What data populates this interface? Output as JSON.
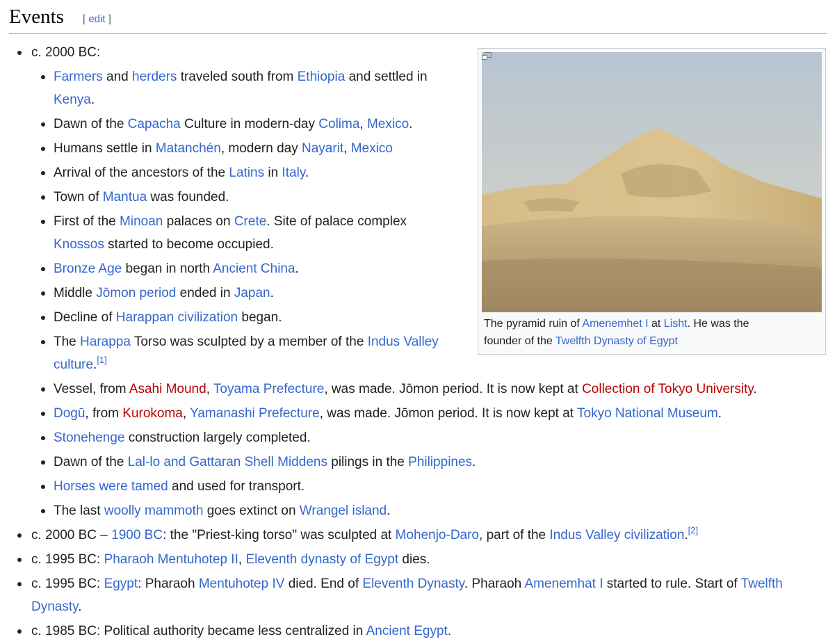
{
  "section": {
    "title": "Events",
    "edit_open": "[ ",
    "edit_label": "edit",
    "edit_close": " ]"
  },
  "figure": {
    "caption": [
      {
        "t": "The pyramid ruin of "
      },
      {
        "t": "Amenemhet I",
        "l": "blue"
      },
      {
        "t": " at "
      },
      {
        "t": "Lisht",
        "l": "blue"
      },
      {
        "t": ". He was the founder of the "
      },
      {
        "t": "Twelfth Dynasty of Egypt",
        "l": "blue"
      }
    ]
  },
  "events": [
    {
      "text": [
        {
          "t": "c. 2000 BC:"
        }
      ],
      "sub": [
        [
          {
            "t": "Farmers",
            "l": "blue"
          },
          {
            "t": " and "
          },
          {
            "t": "herders",
            "l": "blue"
          },
          {
            "t": " traveled south from "
          },
          {
            "t": "Ethiopia",
            "l": "blue"
          },
          {
            "t": " and settled in "
          },
          {
            "t": "Kenya",
            "l": "blue"
          },
          {
            "t": "."
          }
        ],
        [
          {
            "t": "Dawn of the "
          },
          {
            "t": "Capacha",
            "l": "blue"
          },
          {
            "t": " Culture in modern-day "
          },
          {
            "t": "Colima",
            "l": "blue"
          },
          {
            "t": ", "
          },
          {
            "t": "Mexico",
            "l": "blue"
          },
          {
            "t": "."
          }
        ],
        [
          {
            "t": "Humans settle in "
          },
          {
            "t": "Matanchén",
            "l": "blue"
          },
          {
            "t": ", modern day "
          },
          {
            "t": "Nayarit",
            "l": "blue"
          },
          {
            "t": ", "
          },
          {
            "t": "Mexico",
            "l": "blue"
          }
        ],
        [
          {
            "t": "Arrival of the ancestors of the "
          },
          {
            "t": "Latins",
            "l": "blue"
          },
          {
            "t": " in "
          },
          {
            "t": "Italy",
            "l": "blue"
          },
          {
            "t": "."
          }
        ],
        [
          {
            "t": "Town of "
          },
          {
            "t": "Mantua",
            "l": "blue"
          },
          {
            "t": " was founded."
          }
        ],
        [
          {
            "t": "First of the "
          },
          {
            "t": "Minoan",
            "l": "blue"
          },
          {
            "t": " palaces on "
          },
          {
            "t": "Crete",
            "l": "blue"
          },
          {
            "t": ". Site of palace complex "
          },
          {
            "t": "Knossos",
            "l": "blue"
          },
          {
            "t": " started to become occupied."
          }
        ],
        [
          {
            "t": "Bronze Age",
            "l": "blue"
          },
          {
            "t": " began in north "
          },
          {
            "t": "Ancient China",
            "l": "blue"
          },
          {
            "t": "."
          }
        ],
        [
          {
            "t": "Middle "
          },
          {
            "t": "Jōmon period",
            "l": "blue"
          },
          {
            "t": " ended in "
          },
          {
            "t": "Japan",
            "l": "blue"
          },
          {
            "t": "."
          }
        ],
        [
          {
            "t": "Decline of "
          },
          {
            "t": "Harappan civilization",
            "l": "blue"
          },
          {
            "t": " began."
          }
        ],
        [
          {
            "t": "The "
          },
          {
            "t": "Harappa",
            "l": "blue"
          },
          {
            "t": " Torso was sculpted by a member of the "
          },
          {
            "t": "Indus Valley culture",
            "l": "blue"
          },
          {
            "t": "."
          },
          {
            "t": "[1]",
            "l": "blue",
            "s": true
          }
        ],
        [
          {
            "t": "Vessel, from "
          },
          {
            "t": "Asahi Mound",
            "l": "red"
          },
          {
            "t": ", "
          },
          {
            "t": "Toyama Prefecture",
            "l": "blue"
          },
          {
            "t": ", was made. Jōmon period. It is now kept at "
          },
          {
            "t": "Collection of Tokyo University",
            "l": "red"
          },
          {
            "t": "."
          }
        ],
        [
          {
            "t": "Dogū",
            "l": "blue"
          },
          {
            "t": ", from "
          },
          {
            "t": "Kurokoma",
            "l": "red"
          },
          {
            "t": ", "
          },
          {
            "t": "Yamanashi Prefecture",
            "l": "blue"
          },
          {
            "t": ", was made. Jōmon period. It is now kept at "
          },
          {
            "t": "Tokyo National Museum",
            "l": "blue"
          },
          {
            "t": "."
          }
        ],
        [
          {
            "t": "Stonehenge",
            "l": "blue"
          },
          {
            "t": " construction largely completed."
          }
        ],
        [
          {
            "t": "Dawn of the "
          },
          {
            "t": "Lal-lo and Gattaran Shell Middens",
            "l": "blue"
          },
          {
            "t": " pilings in the "
          },
          {
            "t": "Philippines",
            "l": "blue"
          },
          {
            "t": "."
          }
        ],
        [
          {
            "t": "Horses were tamed",
            "l": "blue"
          },
          {
            "t": " and used for transport."
          }
        ],
        [
          {
            "t": "The last "
          },
          {
            "t": "woolly mammoth",
            "l": "blue"
          },
          {
            "t": " goes extinct on "
          },
          {
            "t": "Wrangel island",
            "l": "blue"
          },
          {
            "t": "."
          }
        ]
      ]
    },
    {
      "text": [
        {
          "t": "c. 2000 BC – "
        },
        {
          "t": "1900 BC",
          "l": "blue"
        },
        {
          "t": ": the \"Priest-king torso\" was sculpted at "
        },
        {
          "t": "Mohenjo-Daro",
          "l": "blue"
        },
        {
          "t": ", part of the "
        },
        {
          "t": "Indus Valley civilization",
          "l": "blue"
        },
        {
          "t": "."
        },
        {
          "t": "[2]",
          "l": "blue",
          "s": true
        }
      ]
    },
    {
      "text": [
        {
          "t": "c. 1995 BC: "
        },
        {
          "t": "Pharaoh Mentuhotep II",
          "l": "blue"
        },
        {
          "t": ", "
        },
        {
          "t": "Eleventh dynasty of Egypt",
          "l": "blue"
        },
        {
          "t": " dies."
        }
      ]
    },
    {
      "text": [
        {
          "t": "c. 1995 BC: "
        },
        {
          "t": "Egypt",
          "l": "blue"
        },
        {
          "t": ": Pharaoh "
        },
        {
          "t": "Mentuhotep IV",
          "l": "blue"
        },
        {
          "t": " died. End of "
        },
        {
          "t": "Eleventh Dynasty",
          "l": "blue"
        },
        {
          "t": ". Pharaoh "
        },
        {
          "t": "Amenemhat I",
          "l": "blue"
        },
        {
          "t": " started to rule. Start of "
        },
        {
          "t": "Twelfth Dynasty",
          "l": "blue"
        },
        {
          "t": "."
        }
      ]
    },
    {
      "text": [
        {
          "t": "c. 1985 BC: Political authority became less centralized in "
        },
        {
          "t": "Ancient Egypt",
          "l": "blue"
        },
        {
          "t": "."
        }
      ]
    }
  ]
}
